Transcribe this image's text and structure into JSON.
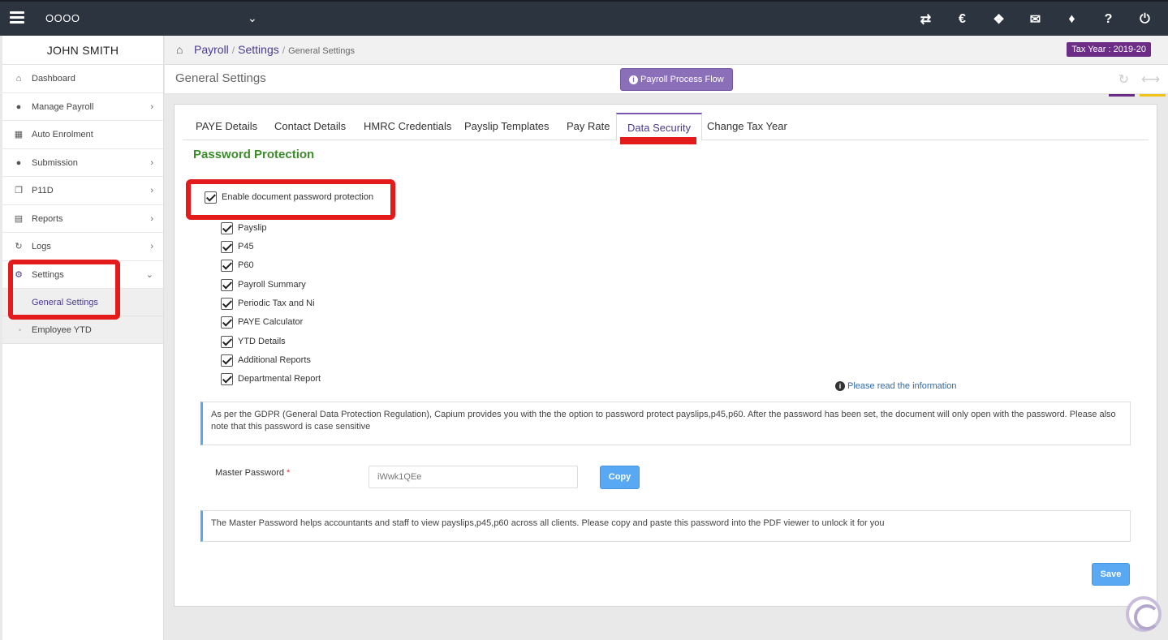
{
  "topbar": {
    "company": "OOOO",
    "icons": [
      "switch-icon",
      "capium-icon",
      "apps-icon",
      "announce-icon",
      "ticket-icon",
      "help-icon",
      "power-icon"
    ]
  },
  "sidebar": {
    "user": "JOHN SMITH",
    "items": [
      {
        "label": "Dashboard",
        "icon": "home-icon"
      },
      {
        "label": "Manage Payroll",
        "icon": "user-icon"
      },
      {
        "label": "Auto Enrolment",
        "icon": "grid-icon"
      },
      {
        "label": "Submission",
        "icon": "users-icon"
      },
      {
        "label": "P11D",
        "icon": "copy-icon"
      },
      {
        "label": "Reports",
        "icon": "report-icon"
      },
      {
        "label": "Logs",
        "icon": "history-icon"
      },
      {
        "label": "Settings",
        "icon": "gear-icon"
      }
    ],
    "sub_items": [
      {
        "label": "General Settings"
      },
      {
        "label": "Employee YTD"
      }
    ]
  },
  "breadcrumb": {
    "items": [
      "Payroll",
      "Settings"
    ],
    "current": "General Settings"
  },
  "tax_year": "Tax Year : 2019-20",
  "page": {
    "title": "General Settings",
    "flow_button": "Payroll Process Flow"
  },
  "tabs": [
    "PAYE Details",
    "Contact Details",
    "HMRC Credentials",
    "Payslip Templates",
    "Pay Rate",
    "Data Security",
    "Change Tax Year"
  ],
  "active_tab": "Data Security",
  "section_title": "Password Protection",
  "enable_label": "Enable document password protection",
  "documents": [
    "Payslip",
    "P45",
    "P60",
    "Payroll Summary",
    "Periodic Tax and Ni",
    "PAYE Calculator",
    "YTD Details",
    "Additional Reports",
    "Departmental Report"
  ],
  "info_link": "Please read the information",
  "gdpr_note": "As per the GDPR (General Data Protection Regulation), Capium provides you with the the option to password protect payslips,p45,p60. After the password has been set, the document will only open with the password. Please also note that this password is case sensitive",
  "master_password": {
    "label": "Master Password",
    "required_mark": "*",
    "value": "iWwk1QEe",
    "copy_label": "Copy"
  },
  "master_note": "The Master Password helps accountants and staff to view payslips,p45,p60 across all clients. Please copy and paste this password into the PDF viewer to unlock it for you",
  "save_label": "Save",
  "colors": {
    "topbar": "#2c3440",
    "accent_purple": "#4b3b8f",
    "section_green": "#3c8c2c",
    "button_blue": "#59a8f3",
    "highlight_red": "#e31b1b"
  }
}
